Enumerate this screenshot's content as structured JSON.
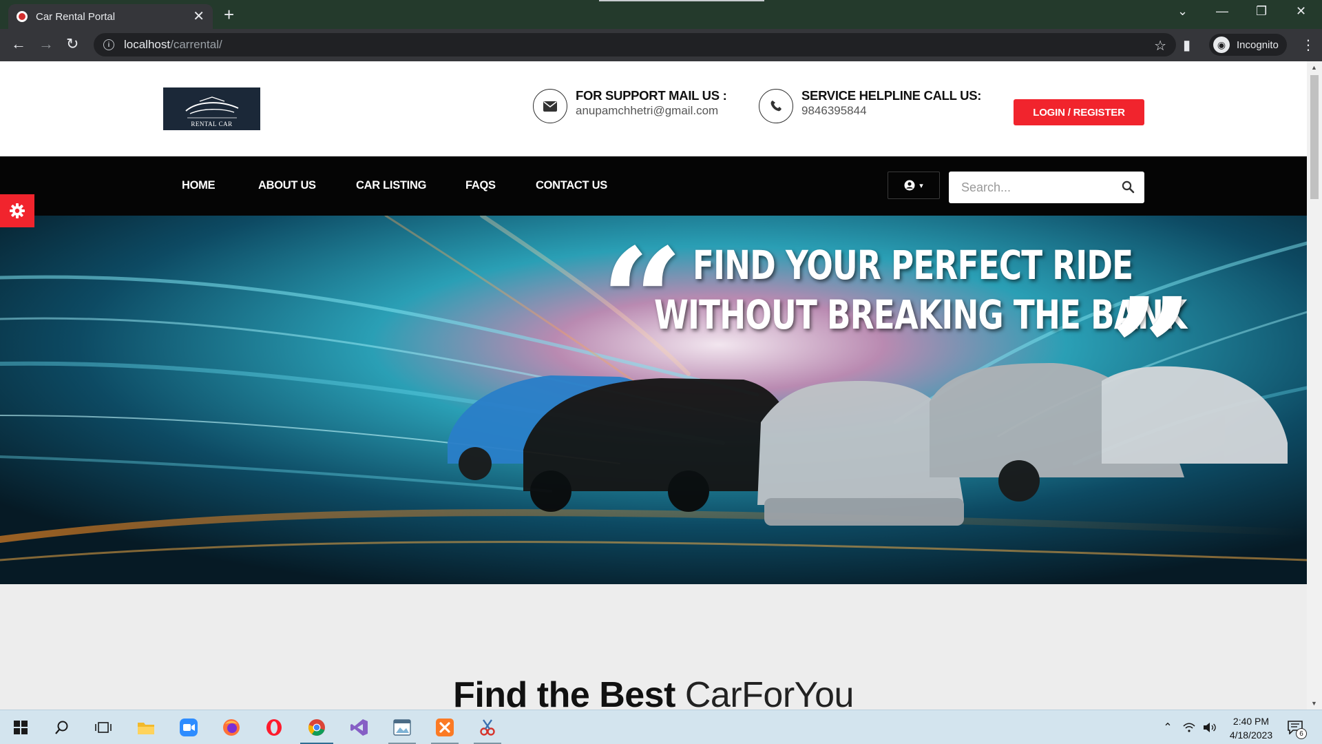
{
  "browser": {
    "tab_title": "Car Rental Portal",
    "tab_close": "✕",
    "new_tab": "+",
    "url_host": "localhost",
    "url_path": "/carrental/",
    "profile_label": "Incognito"
  },
  "header": {
    "logo_text": "RENTAL CAR",
    "support": {
      "label": "FOR SUPPORT MAIL US :",
      "value": "anupamchhetri@gmail.com"
    },
    "helpline": {
      "label": "SERVICE HELPLINE CALL US:",
      "value": "9846395844"
    },
    "login_label": "LOGIN / REGISTER"
  },
  "nav": {
    "items": [
      {
        "label": "HOME"
      },
      {
        "label": "ABOUT US"
      },
      {
        "label": "CAR LISTING"
      },
      {
        "label": "FAQS"
      },
      {
        "label": "CONTACT US"
      }
    ],
    "search_placeholder": "Search..."
  },
  "hero": {
    "line1": "FIND YOUR PERFECT RIDE",
    "line2": "WITHOUT BREAKING THE BANK",
    "open_quote": "“",
    "close_quote": "”"
  },
  "section": {
    "title_strong": "Find the Best",
    "title_light": "CarForYou"
  },
  "taskbar": {
    "time": "2:40 PM",
    "date": "4/18/2023",
    "notification_count": "6"
  },
  "colors": {
    "accent_red": "#f1242d",
    "nav_black": "#050505",
    "tabbar_green": "#243a2c"
  }
}
